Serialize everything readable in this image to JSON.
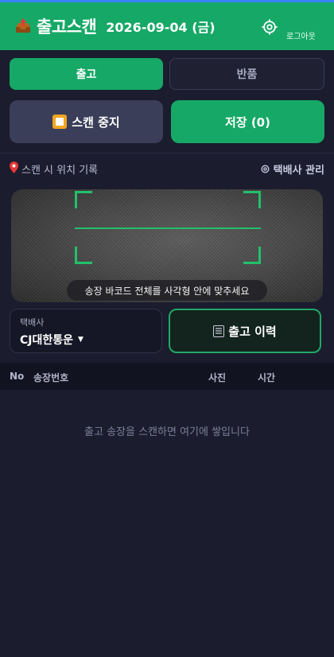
{
  "header": {
    "title": "출고스캔",
    "date": "2026-09-04 (금)",
    "logout_label": "로그아웃"
  },
  "tabs": [
    {
      "label": "출고",
      "active": true
    },
    {
      "label": "반품",
      "active": false
    }
  ],
  "actions": {
    "stop_scan_label": "스캔 중지",
    "save_label": "저장 (0)"
  },
  "location": {
    "record_label": "스캔 시 위치 기록",
    "courier_manage_label": "택배사 관리"
  },
  "camera": {
    "hint": "송장 바코드 전체를 사각형 안에 맞추세요"
  },
  "courier": {
    "label": "택배사",
    "selected": "CJ대한통운"
  },
  "history_label": "출고 이력",
  "table": {
    "columns": [
      "No",
      "송장번호",
      "사진",
      "시간"
    ],
    "empty_message": "출고 송장을 스캔하면 여기에 쌓입니다"
  },
  "colors": {
    "brand": "#16a866",
    "background": "#1b1c2e",
    "accent_stop": "#f0a623"
  }
}
